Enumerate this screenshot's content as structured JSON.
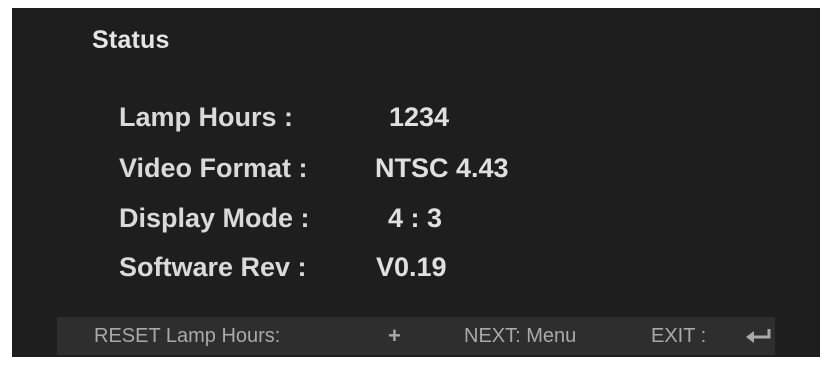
{
  "status": {
    "title": "Status",
    "rows": [
      {
        "label": "Lamp Hours :",
        "value": "1234"
      },
      {
        "label": "Video Format :",
        "value": "NTSC 4.43"
      },
      {
        "label": "Display Mode :",
        "value": "4 : 3"
      },
      {
        "label": "Software Rev :",
        "value": "V0.19"
      }
    ]
  },
  "footer": {
    "reset_label": "RESET Lamp Hours:",
    "reset_key": "+",
    "next_label": "NEXT: Menu",
    "exit_label": "EXIT :",
    "exit_icon": "enter-return-icon"
  },
  "colors": {
    "background": "#1e1e1e",
    "footer_bar": "#2e2e2e",
    "text": "#dadada",
    "footer_text": "#a9a9a9"
  }
}
